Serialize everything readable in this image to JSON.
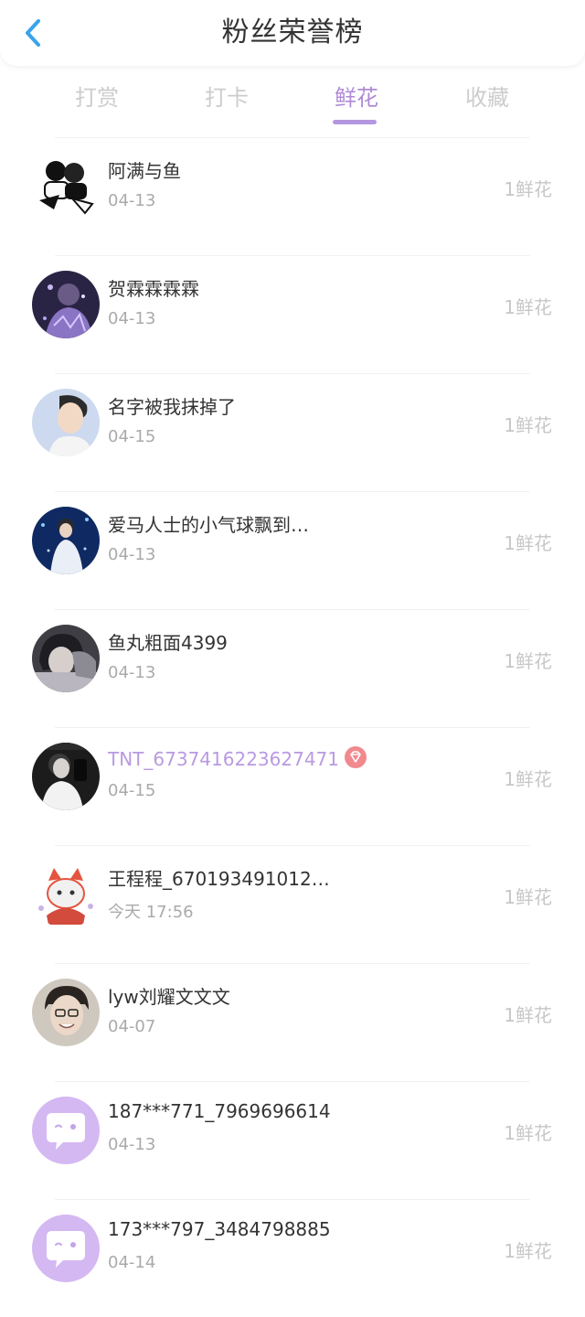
{
  "header": {
    "title": "粉丝荣誉榜",
    "back_icon": "chevron-left-icon",
    "accent_color": "#3aa3ec"
  },
  "tabs": [
    {
      "label": "打赏",
      "active": false
    },
    {
      "label": "打卡",
      "active": false
    },
    {
      "label": "鲜花",
      "active": true
    },
    {
      "label": "收藏",
      "active": false
    }
  ],
  "colors": {
    "tab_active": "#b08ad6",
    "tab_inactive": "#cccccc",
    "vip_name": "#b99ae2",
    "badge": "#f08a8f"
  },
  "fans": [
    {
      "name": "阿满与鱼",
      "date": "04-13",
      "amount": "1鲜花",
      "avatar": "cartoon-couple-avatar",
      "vip": false
    },
    {
      "name": "贺霖霖霖霖",
      "date": "04-13",
      "amount": "1鲜花",
      "avatar": "purple-photo-avatar",
      "vip": false
    },
    {
      "name": "名字被我抹掉了",
      "date": "04-15",
      "amount": "1鲜花",
      "avatar": "portrait-avatar",
      "vip": false
    },
    {
      "name": "爱马人士的小气球飘到…",
      "date": "04-13",
      "amount": "1鲜花",
      "avatar": "stage-photo-avatar",
      "vip": false
    },
    {
      "name": "鱼丸粗面4399",
      "date": "04-13",
      "amount": "1鲜花",
      "avatar": "gray-photo-avatar",
      "vip": false
    },
    {
      "name": "TNT_6737416223627471",
      "date": "04-15",
      "amount": "1鲜花",
      "avatar": "dark-photo-avatar",
      "vip": true,
      "badge_icon": "diamond-icon"
    },
    {
      "name": "王程程_670193491012…",
      "date": "今天 17:56",
      "amount": "1鲜花",
      "avatar": "fox-cartoon-avatar",
      "vip": false
    },
    {
      "name": "lyw刘耀文文文",
      "date": "04-07",
      "amount": "1鲜花",
      "avatar": "smiling-portrait-avatar",
      "vip": false
    },
    {
      "name": "187***771_7969696614",
      "date": "04-13",
      "amount": "1鲜花",
      "avatar": "default-chat-avatar",
      "vip": false
    },
    {
      "name": "173***797_3484798885",
      "date": "04-14",
      "amount": "1鲜花",
      "avatar": "default-chat-avatar",
      "vip": false
    }
  ]
}
